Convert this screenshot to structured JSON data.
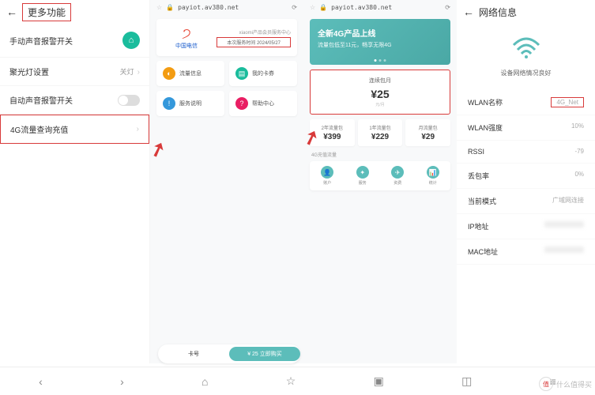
{
  "col1": {
    "title": "更多功能",
    "rows": [
      {
        "label": "手动声音报警开关",
        "kind": "icon"
      },
      {
        "label": "聚光灯设置",
        "value": "关灯",
        "kind": "chev"
      },
      {
        "label": "自动声音报警开关",
        "kind": "toggle"
      },
      {
        "label": "4G流量查询充值",
        "kind": "chev",
        "hl": true
      }
    ]
  },
  "browser": {
    "url": "payiot.av380.net"
  },
  "telecom": {
    "brand": "中国电信",
    "line1": "xiaomi产品会员服务中心",
    "line2": "本次服务时间 2024/05/27"
  },
  "grid": [
    {
      "label": "流量信息",
      "color": "orange",
      "glyph": "◐"
    },
    {
      "label": "我的卡券",
      "color": "tealb",
      "glyph": "▤"
    },
    {
      "label": "服务说明",
      "color": "blue",
      "glyph": "!"
    },
    {
      "label": "帮助中心",
      "color": "pink",
      "glyph": "?"
    }
  ],
  "banner": {
    "title": "全新4G产品上线",
    "sub": "流量包低至11元，畅享无限4G"
  },
  "featured": {
    "title": "连续包月",
    "price": "25",
    "unit": "元/月"
  },
  "packs": [
    {
      "title": "2年流量包",
      "price": "399"
    },
    {
      "title": "1年流量包",
      "price": "229"
    },
    {
      "title": "月流量包",
      "price": "29"
    }
  ],
  "recharge": {
    "label": "4G充值流量"
  },
  "iconrow": [
    {
      "glyph": "👤",
      "label": "账户"
    },
    {
      "glyph": "✦",
      "label": "服务"
    },
    {
      "glyph": "✈",
      "label": "资费"
    },
    {
      "glyph": "📊",
      "label": "统计"
    }
  ],
  "minibar": {
    "left": "卡号",
    "right": "¥ 25 立即购买"
  },
  "net": {
    "title": "网络信息",
    "wifi_status": "设备网络情况良好",
    "rows": [
      {
        "k": "WLAN名称",
        "v": "4G_Net",
        "hl": true
      },
      {
        "k": "WLAN强度",
        "v": "10%"
      },
      {
        "k": "RSSI",
        "v": "-79"
      },
      {
        "k": "丢包率",
        "v": "0%"
      },
      {
        "k": "当前模式",
        "v": "广域网连接"
      },
      {
        "k": "IP地址",
        "v": "blur"
      },
      {
        "k": "MAC地址",
        "v": "blur"
      }
    ]
  },
  "watermark": {
    "brand": "值",
    "text": "什么值得买"
  }
}
